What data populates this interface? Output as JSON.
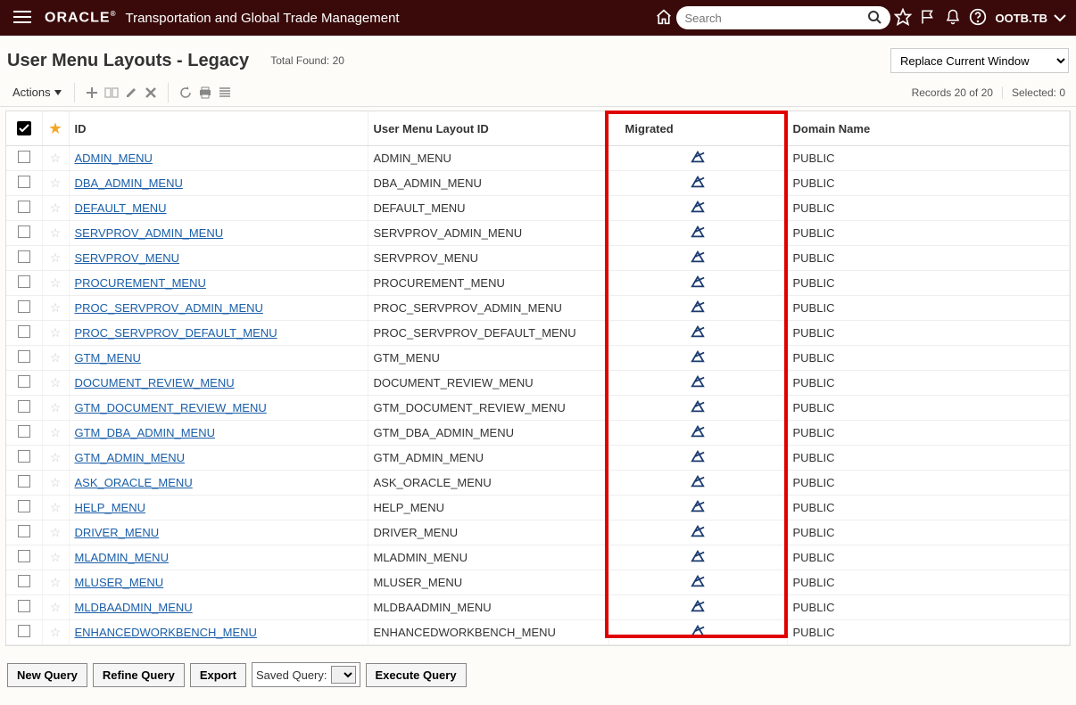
{
  "header": {
    "brand": "ORACLE",
    "app_title": "Transportation and Global Trade Management",
    "search_placeholder": "Search",
    "user": "OOTB.TB"
  },
  "page": {
    "title": "User Menu Layouts - Legacy",
    "total_found": "Total Found: 20",
    "replace_option": "Replace Current Window",
    "actions_label": "Actions",
    "records_info": "Records 20 of 20",
    "selected_info": "Selected: 0"
  },
  "columns": {
    "id": "ID",
    "layout": "User Menu Layout ID",
    "migrated": "Migrated",
    "domain": "Domain Name"
  },
  "rows": [
    {
      "id": "ADMIN_MENU",
      "layout": "ADMIN_MENU",
      "domain": "PUBLIC"
    },
    {
      "id": "DBA_ADMIN_MENU",
      "layout": "DBA_ADMIN_MENU",
      "domain": "PUBLIC"
    },
    {
      "id": "DEFAULT_MENU",
      "layout": "DEFAULT_MENU",
      "domain": "PUBLIC"
    },
    {
      "id": "SERVPROV_ADMIN_MENU",
      "layout": "SERVPROV_ADMIN_MENU",
      "domain": "PUBLIC"
    },
    {
      "id": "SERVPROV_MENU",
      "layout": "SERVPROV_MENU",
      "domain": "PUBLIC"
    },
    {
      "id": "PROCUREMENT_MENU",
      "layout": "PROCUREMENT_MENU",
      "domain": "PUBLIC"
    },
    {
      "id": "PROC_SERVPROV_ADMIN_MENU",
      "layout": "PROC_SERVPROV_ADMIN_MENU",
      "domain": "PUBLIC"
    },
    {
      "id": "PROC_SERVPROV_DEFAULT_MENU",
      "layout": "PROC_SERVPROV_DEFAULT_MENU",
      "domain": "PUBLIC"
    },
    {
      "id": "GTM_MENU",
      "layout": "GTM_MENU",
      "domain": "PUBLIC"
    },
    {
      "id": "DOCUMENT_REVIEW_MENU",
      "layout": "DOCUMENT_REVIEW_MENU",
      "domain": "PUBLIC"
    },
    {
      "id": "GTM_DOCUMENT_REVIEW_MENU",
      "layout": "GTM_DOCUMENT_REVIEW_MENU",
      "domain": "PUBLIC"
    },
    {
      "id": "GTM_DBA_ADMIN_MENU",
      "layout": "GTM_DBA_ADMIN_MENU",
      "domain": "PUBLIC"
    },
    {
      "id": "GTM_ADMIN_MENU",
      "layout": "GTM_ADMIN_MENU",
      "domain": "PUBLIC"
    },
    {
      "id": "ASK_ORACLE_MENU",
      "layout": "ASK_ORACLE_MENU",
      "domain": "PUBLIC"
    },
    {
      "id": "HELP_MENU",
      "layout": "HELP_MENU",
      "domain": "PUBLIC"
    },
    {
      "id": "DRIVER_MENU",
      "layout": "DRIVER_MENU",
      "domain": "PUBLIC"
    },
    {
      "id": "MLADMIN_MENU",
      "layout": "MLADMIN_MENU",
      "domain": "PUBLIC"
    },
    {
      "id": "MLUSER_MENU",
      "layout": "MLUSER_MENU",
      "domain": "PUBLIC"
    },
    {
      "id": "MLDBAADMIN_MENU",
      "layout": "MLDBAADMIN_MENU",
      "domain": "PUBLIC"
    },
    {
      "id": "ENHANCEDWORKBENCH_MENU",
      "layout": "ENHANCEDWORKBENCH_MENU",
      "domain": "PUBLIC"
    }
  ],
  "bottom": {
    "new_query": "New Query",
    "refine_query": "Refine Query",
    "export": "Export",
    "saved_query_label": "Saved Query:",
    "execute_query": "Execute Query"
  }
}
